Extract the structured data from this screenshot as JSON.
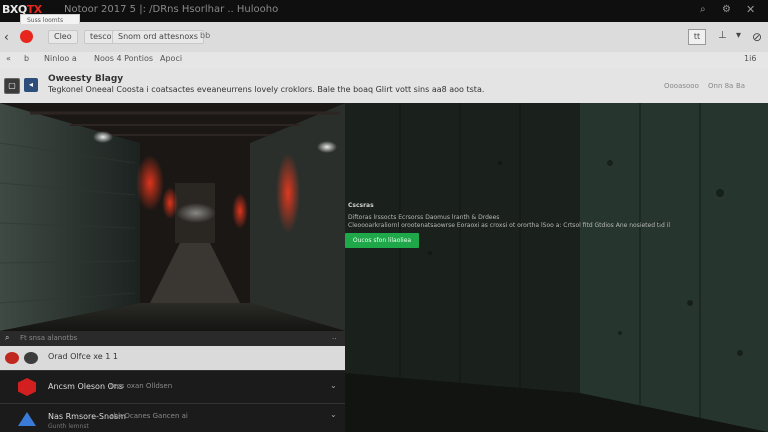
{
  "title_bar": {
    "logo_prefix": "BXQ",
    "logo_suffix": "TX",
    "window_title": "Notoor 2017 5 |: /DRns Hsorlhar .. Hulooho"
  },
  "tabs": {
    "active_tab_label": "Suss loomts",
    "items": [
      {
        "label": "Cleo"
      },
      {
        "label": "tesco"
      },
      {
        "label": "Snom ord attesnoxs"
      }
    ],
    "extra": "bb"
  },
  "toolbar": {
    "box_label": "tt"
  },
  "bookmarks": [
    {
      "label": "«"
    },
    {
      "label": "b"
    },
    {
      "label": "Ninloo a"
    },
    {
      "label": "Noos 4 Pontios"
    },
    {
      "label": "Apoci"
    }
  ],
  "bookmarks_right": "1i6",
  "info_bar": {
    "title": "Oweesty Blagy",
    "text": "Tegkonel Oneeal  Coosta i coatsactes eveaneurrens lovely croklors. Bale the boaq Glirt vott sins aa8 aoo tsta.",
    "right_items": [
      "Oooasooo",
      "Onn 8a",
      "Ba"
    ]
  },
  "dialog": {
    "title": "Cscsras",
    "line1": "Diftoras lrssocts Ecrsorss  Daomus lranth & Drdees",
    "line2": "Cleoooarkraliornl orootenatsaowrse Eoraoxi as croxsi ot orortha lSoo a: Crtsol fitd Gtdios Ane nosieted tid il",
    "button": "Oucos sfon lilaoliea"
  },
  "bottom_panel": {
    "search_placeholder": "Ft snsa alanotbs",
    "search_right": "..",
    "row1": "Orad Olfce xe 1 1",
    "row2": {
      "title": "Ancsm Oleson Ons",
      "sub": "tecs oxan  Olldsen"
    },
    "row3": {
      "title": "Nas Rmsore-Snosm",
      "sub": "sbk Ocanes Gancen ai",
      "line2": "Gunth lemnst"
    }
  },
  "colors": {
    "accent_red": "#e8261d",
    "accent_green": "#1ea84a",
    "scene_dark": "#161a17"
  }
}
